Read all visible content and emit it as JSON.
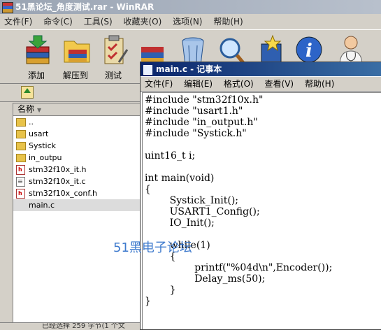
{
  "winrar": {
    "title": "51黑论坛_角度测试.rar - WinRAR",
    "menu": [
      "文件(F)",
      "命令(C)",
      "工具(S)",
      "收藏夹(O)",
      "选项(N)",
      "帮助(H)"
    ],
    "toolbar": [
      {
        "label": "添加",
        "icon": "books-add-icon"
      },
      {
        "label": "解压到",
        "icon": "folder-extract-icon"
      },
      {
        "label": "测试",
        "icon": "clipboard-test-icon"
      },
      {
        "label": "",
        "icon": "books-view-icon"
      },
      {
        "label": "",
        "icon": "trash-icon"
      },
      {
        "label": "",
        "icon": "magnifier-icon"
      },
      {
        "label": "",
        "icon": "wizard-icon"
      },
      {
        "label": "",
        "icon": "info-icon"
      },
      {
        "label": "",
        "icon": "doctor-icon"
      }
    ],
    "column_header": "名称",
    "files": [
      {
        "name": "..",
        "type": "folder"
      },
      {
        "name": "usart",
        "type": "folder"
      },
      {
        "name": "Systick",
        "type": "folder"
      },
      {
        "name": "in_outpu",
        "type": "folder"
      },
      {
        "name": "stm32f10x_it.h",
        "type": "h"
      },
      {
        "name": "stm32f10x_it.c",
        "type": "c"
      },
      {
        "name": "stm32f10x_conf.h",
        "type": "h"
      },
      {
        "name": "main.c",
        "type": "c",
        "selected": true
      }
    ],
    "status_text": "已经选择 259 字节(1 个文"
  },
  "notepad": {
    "title": "main.c - 记事本",
    "menu": [
      "文件(F)",
      "编辑(E)",
      "格式(O)",
      "查看(V)",
      "帮助(H)"
    ],
    "code": "#include \"stm32f10x.h\"\n#include \"usart1.h\"\n#include \"in_output.h\"\n#include \"Systick.h\"\n\nuint16_t i;\n\nint main(void)\n{\n        Systick_Init();\n        USART1_Config();\n        IO_Init();\n\n        while(1)\n        {\n                printf(\"%04d\\n\",Encoder());\n                Delay_ms(50);\n        }\n}"
  },
  "watermark": "51黑电子论坛",
  "colors": {
    "notepad_titlebar": "#0a246a",
    "watermark": "#2a6cc8",
    "window_bg": "#d4d0c8"
  }
}
